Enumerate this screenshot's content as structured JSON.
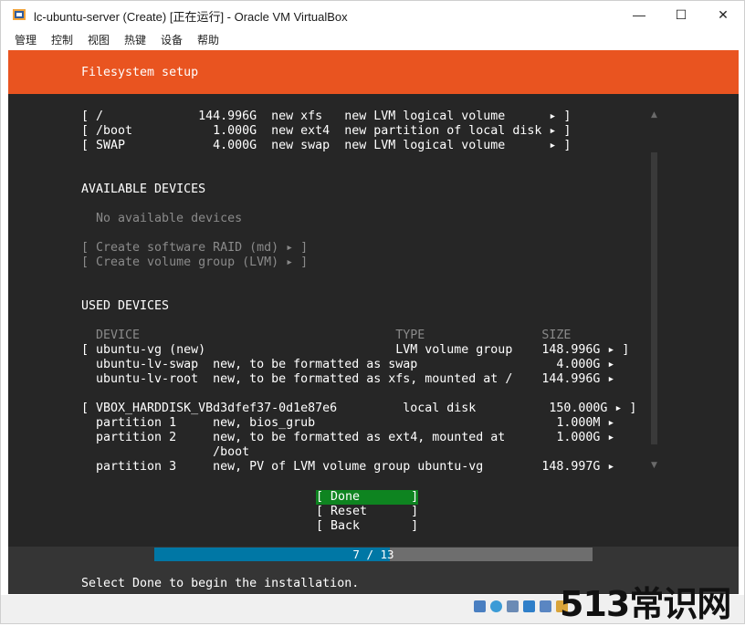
{
  "window": {
    "title": "lc-ubuntu-server (Create) [正在运行] - Oracle VM VirtualBox",
    "controls": {
      "minimize": "—",
      "maximize": "☐",
      "close": "✕"
    }
  },
  "menu": [
    "管理",
    "控制",
    "视图",
    "热键",
    "设备",
    "帮助"
  ],
  "installer": {
    "header": "Filesystem setup",
    "summary_rows": [
      "[ /             144.996G  new xfs   new LVM logical volume      ▸ ]",
      "[ /boot           1.000G  new ext4  new partition of local disk ▸ ]",
      "[ SWAP            4.000G  new swap  new LVM logical volume      ▸ ]"
    ],
    "available_heading": "AVAILABLE DEVICES",
    "no_devices": "No available devices",
    "raid_action": "[ Create software RAID (md) ▸ ]",
    "vg_action": "[ Create volume group (LVM) ▸ ]",
    "used_heading": "USED DEVICES",
    "used_header": "  DEVICE                                   TYPE                SIZE",
    "used_rows": [
      "[ ubuntu-vg (new)                          LVM volume group    148.996G ▸ ]",
      "  ubuntu-lv-swap  new, to be formatted as swap                   4.000G ▸",
      "  ubuntu-lv-root  new, to be formatted as xfs, mounted at /    144.996G ▸",
      "",
      "[ VBOX_HARDDISK_VBd3dfef37-0d1e87e6         local disk          150.000G ▸ ]",
      "  partition 1     new, bios_grub                                 1.000M ▸",
      "  partition 2     new, to be formatted as ext4, mounted at       1.000G ▸",
      "                  /boot",
      "  partition 3     new, PV of LVM volume group ubuntu-vg        148.997G ▸"
    ],
    "buttons": {
      "done": "[ Done       ]",
      "reset": "[ Reset      ]",
      "back": "[ Back       ]"
    },
    "progress": {
      "text": "7 / 13",
      "value": 7,
      "total": 13
    },
    "status": "Select Done to begin the installation."
  },
  "watermark": "513常识网",
  "colors": {
    "header": "#e95420",
    "terminal_bg": "#262626",
    "done_highlight": "#0e8420",
    "progress_fill": "#0077a5"
  },
  "status_icons": [
    "hard-disk-icon",
    "optical-disk-icon",
    "audio-icon",
    "network-icon",
    "usb-icon",
    "shared-folder-icon",
    "display-icon",
    "recording-icon"
  ]
}
